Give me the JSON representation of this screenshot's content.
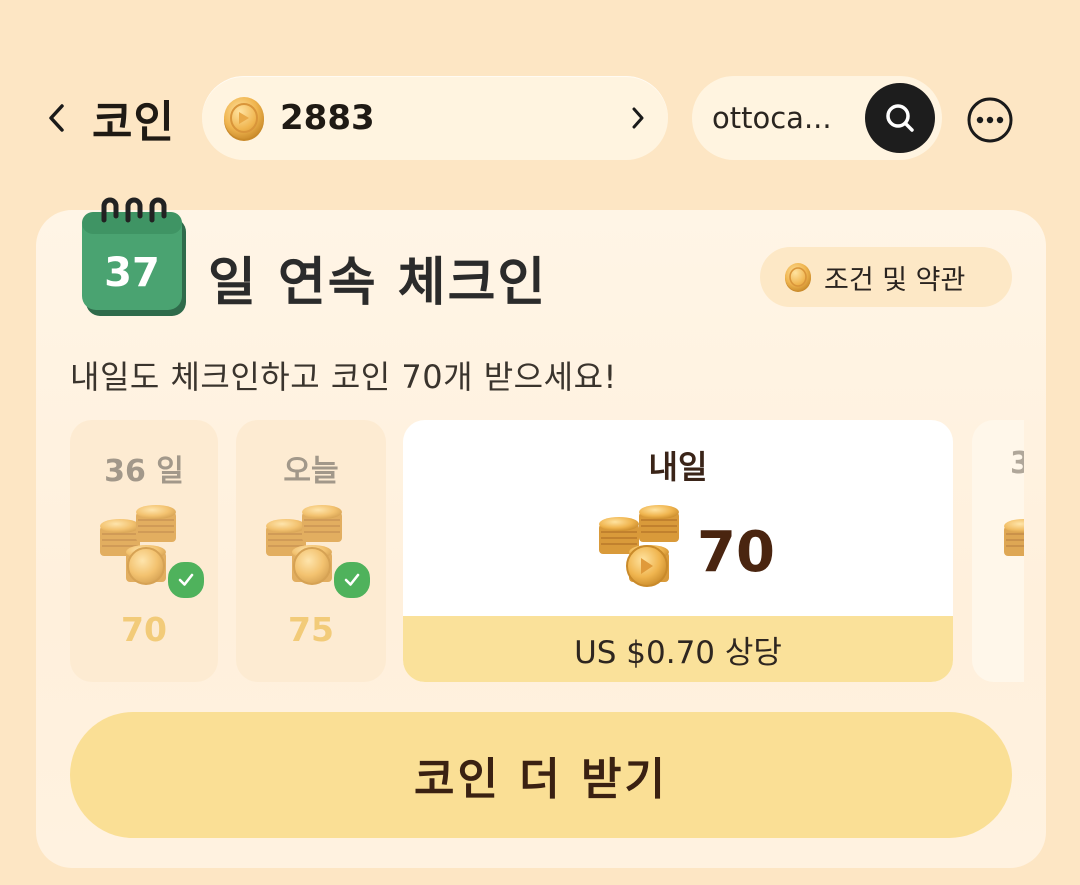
{
  "header": {
    "back_icon": "chevron-left-icon",
    "title": "코인",
    "balance": "2883",
    "user_name": "ottoca...",
    "search_icon": "search-icon",
    "more_icon": "more-horizontal-icon"
  },
  "checkin": {
    "streak_days": "37",
    "title": "일 연속 체크인",
    "terms_label": "조건 및 약관",
    "subtitle": "내일도 체크인하고 코인 70개 받으세요!",
    "days": [
      {
        "label": "36 일",
        "value": "70",
        "claimed": true
      },
      {
        "label": "오늘",
        "value": "75",
        "claimed": true
      }
    ],
    "tomorrow": {
      "label": "내일",
      "value": "70",
      "usd": "US $0.70 상당"
    },
    "next_peek_label": "3"
  },
  "cta_label": "코인 더 받기",
  "colors": {
    "background": "#fde6c4",
    "coin_gold": "#e8a73c",
    "check_green": "#4fb25c",
    "cta_yellow": "#fadf95",
    "calendar_green": "#4aa371"
  }
}
